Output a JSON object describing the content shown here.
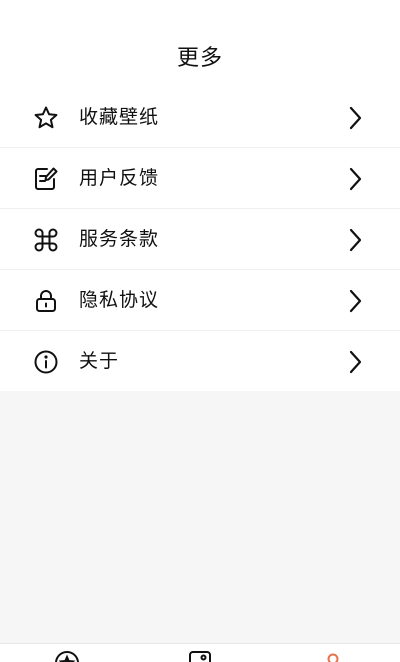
{
  "header": {
    "title": "更多"
  },
  "menu": {
    "items": [
      {
        "label": "收藏壁纸",
        "icon": "star-icon"
      },
      {
        "label": "用户反馈",
        "icon": "feedback-edit-icon"
      },
      {
        "label": "服务条款",
        "icon": "command-icon"
      },
      {
        "label": "隐私协议",
        "icon": "lock-icon"
      },
      {
        "label": "关于",
        "icon": "info-icon"
      }
    ]
  },
  "tabbar": {
    "tabs": [
      {
        "icon": "home-star-icon",
        "active": false
      },
      {
        "icon": "wallpaper-icon",
        "active": false
      },
      {
        "icon": "user-icon",
        "active": true
      }
    ]
  },
  "colors": {
    "accent": "#e8734a",
    "text": "#111111",
    "background": "#f6f6f6"
  }
}
